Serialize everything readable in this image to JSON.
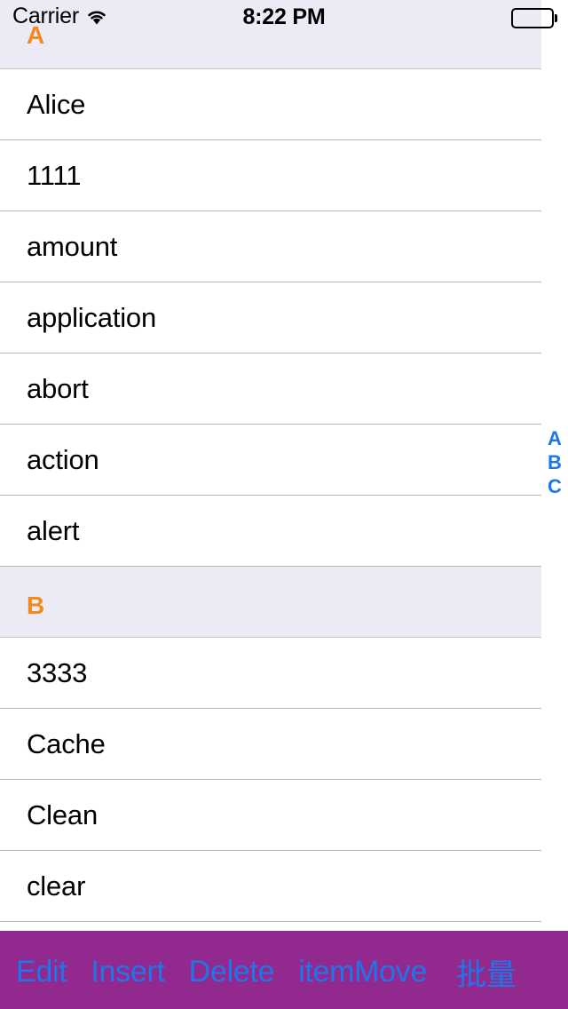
{
  "status_bar": {
    "carrier": "Carrier",
    "wifi_icon": "wifi-icon",
    "time": "8:22 PM",
    "battery_icon": "battery-full-icon"
  },
  "colors": {
    "section_header_bg": "#eceaf5",
    "section_header_text": "#f08a1e",
    "toolbar_bg": "#92298e",
    "toolbar_text": "#1f76e8",
    "index_text": "#1f76e8",
    "separator": "#b8b8b8",
    "row_bg": "#ffffff"
  },
  "table": {
    "sections": [
      {
        "title": "A",
        "rows": [
          {
            "label": "Alice"
          },
          {
            "label": "1111"
          },
          {
            "label": "amount"
          },
          {
            "label": "application"
          },
          {
            "label": "abort"
          },
          {
            "label": "action"
          },
          {
            "label": "alert"
          }
        ]
      },
      {
        "title": "B",
        "rows": [
          {
            "label": "3333"
          },
          {
            "label": "Cache"
          },
          {
            "label": "Clean"
          },
          {
            "label": "clear"
          }
        ]
      }
    ]
  },
  "index_bar": {
    "entries": [
      "A",
      "B",
      "C"
    ]
  },
  "toolbar": {
    "buttons": [
      {
        "label": "Edit",
        "name": "edit-button"
      },
      {
        "label": "Insert",
        "name": "insert-button"
      },
      {
        "label": "Delete",
        "name": "delete-button"
      },
      {
        "label": "itemMove",
        "name": "item-move-button"
      },
      {
        "label": "批量",
        "name": "batch-button"
      }
    ]
  }
}
